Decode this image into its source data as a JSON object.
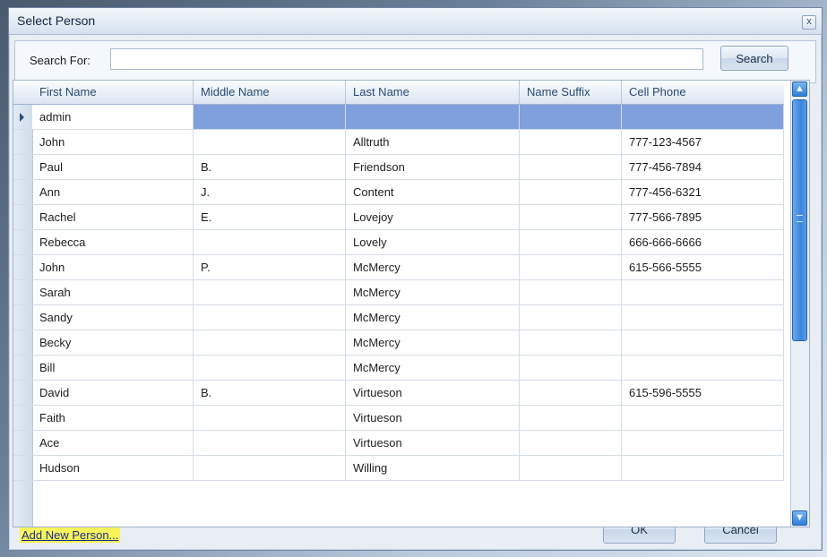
{
  "window": {
    "title": "Select Person",
    "close_glyph": "x"
  },
  "search": {
    "label": "Search For:",
    "value": "",
    "button_label": "Search"
  },
  "grid": {
    "columns": [
      "First Name",
      "Middle Name",
      "Last Name",
      "Name Suffix",
      "Cell Phone"
    ],
    "rows": [
      {
        "first": "admin",
        "middle": "",
        "last": "",
        "suffix": "",
        "phone": "",
        "selected": true
      },
      {
        "first": "John",
        "middle": "",
        "last": "Alltruth",
        "suffix": "",
        "phone": "777-123-4567"
      },
      {
        "first": "Paul",
        "middle": "B.",
        "last": "Friendson",
        "suffix": "",
        "phone": "777-456-7894"
      },
      {
        "first": "Ann",
        "middle": "J.",
        "last": "Content",
        "suffix": "",
        "phone": "777-456-6321"
      },
      {
        "first": "Rachel",
        "middle": "E.",
        "last": "Lovejoy",
        "suffix": "",
        "phone": "777-566-7895"
      },
      {
        "first": "Rebecca",
        "middle": "",
        "last": "Lovely",
        "suffix": "",
        "phone": "666-666-6666"
      },
      {
        "first": "John",
        "middle": "P.",
        "last": "McMercy",
        "suffix": "",
        "phone": "615-566-5555"
      },
      {
        "first": "Sarah",
        "middle": "",
        "last": "McMercy",
        "suffix": "",
        "phone": ""
      },
      {
        "first": "Sandy",
        "middle": "",
        "last": "McMercy",
        "suffix": "",
        "phone": ""
      },
      {
        "first": "Becky",
        "middle": "",
        "last": "McMercy",
        "suffix": "",
        "phone": ""
      },
      {
        "first": "Bill",
        "middle": "",
        "last": "McMercy",
        "suffix": "",
        "phone": ""
      },
      {
        "first": "David",
        "middle": "B.",
        "last": "Virtueson",
        "suffix": "",
        "phone": "615-596-5555"
      },
      {
        "first": "Faith",
        "middle": "",
        "last": "Virtueson",
        "suffix": "",
        "phone": ""
      },
      {
        "first": "Ace",
        "middle": "",
        "last": "Virtueson",
        "suffix": "",
        "phone": ""
      },
      {
        "first": "Hudson",
        "middle": "",
        "last": "Willing",
        "suffix": "",
        "phone": ""
      }
    ]
  },
  "footer": {
    "add_link": "Add New Person...",
    "ok_label": "OK",
    "cancel_label": "Cancel"
  },
  "icons": {
    "row_indicator": "current-row-arrow-icon",
    "scroll_up": "chevron-up-icon",
    "scroll_down": "chevron-down-icon"
  },
  "colors": {
    "selected_row": "#7f9fdd",
    "link_highlight": "#f6f45a",
    "header_text": "#2a4a72"
  }
}
